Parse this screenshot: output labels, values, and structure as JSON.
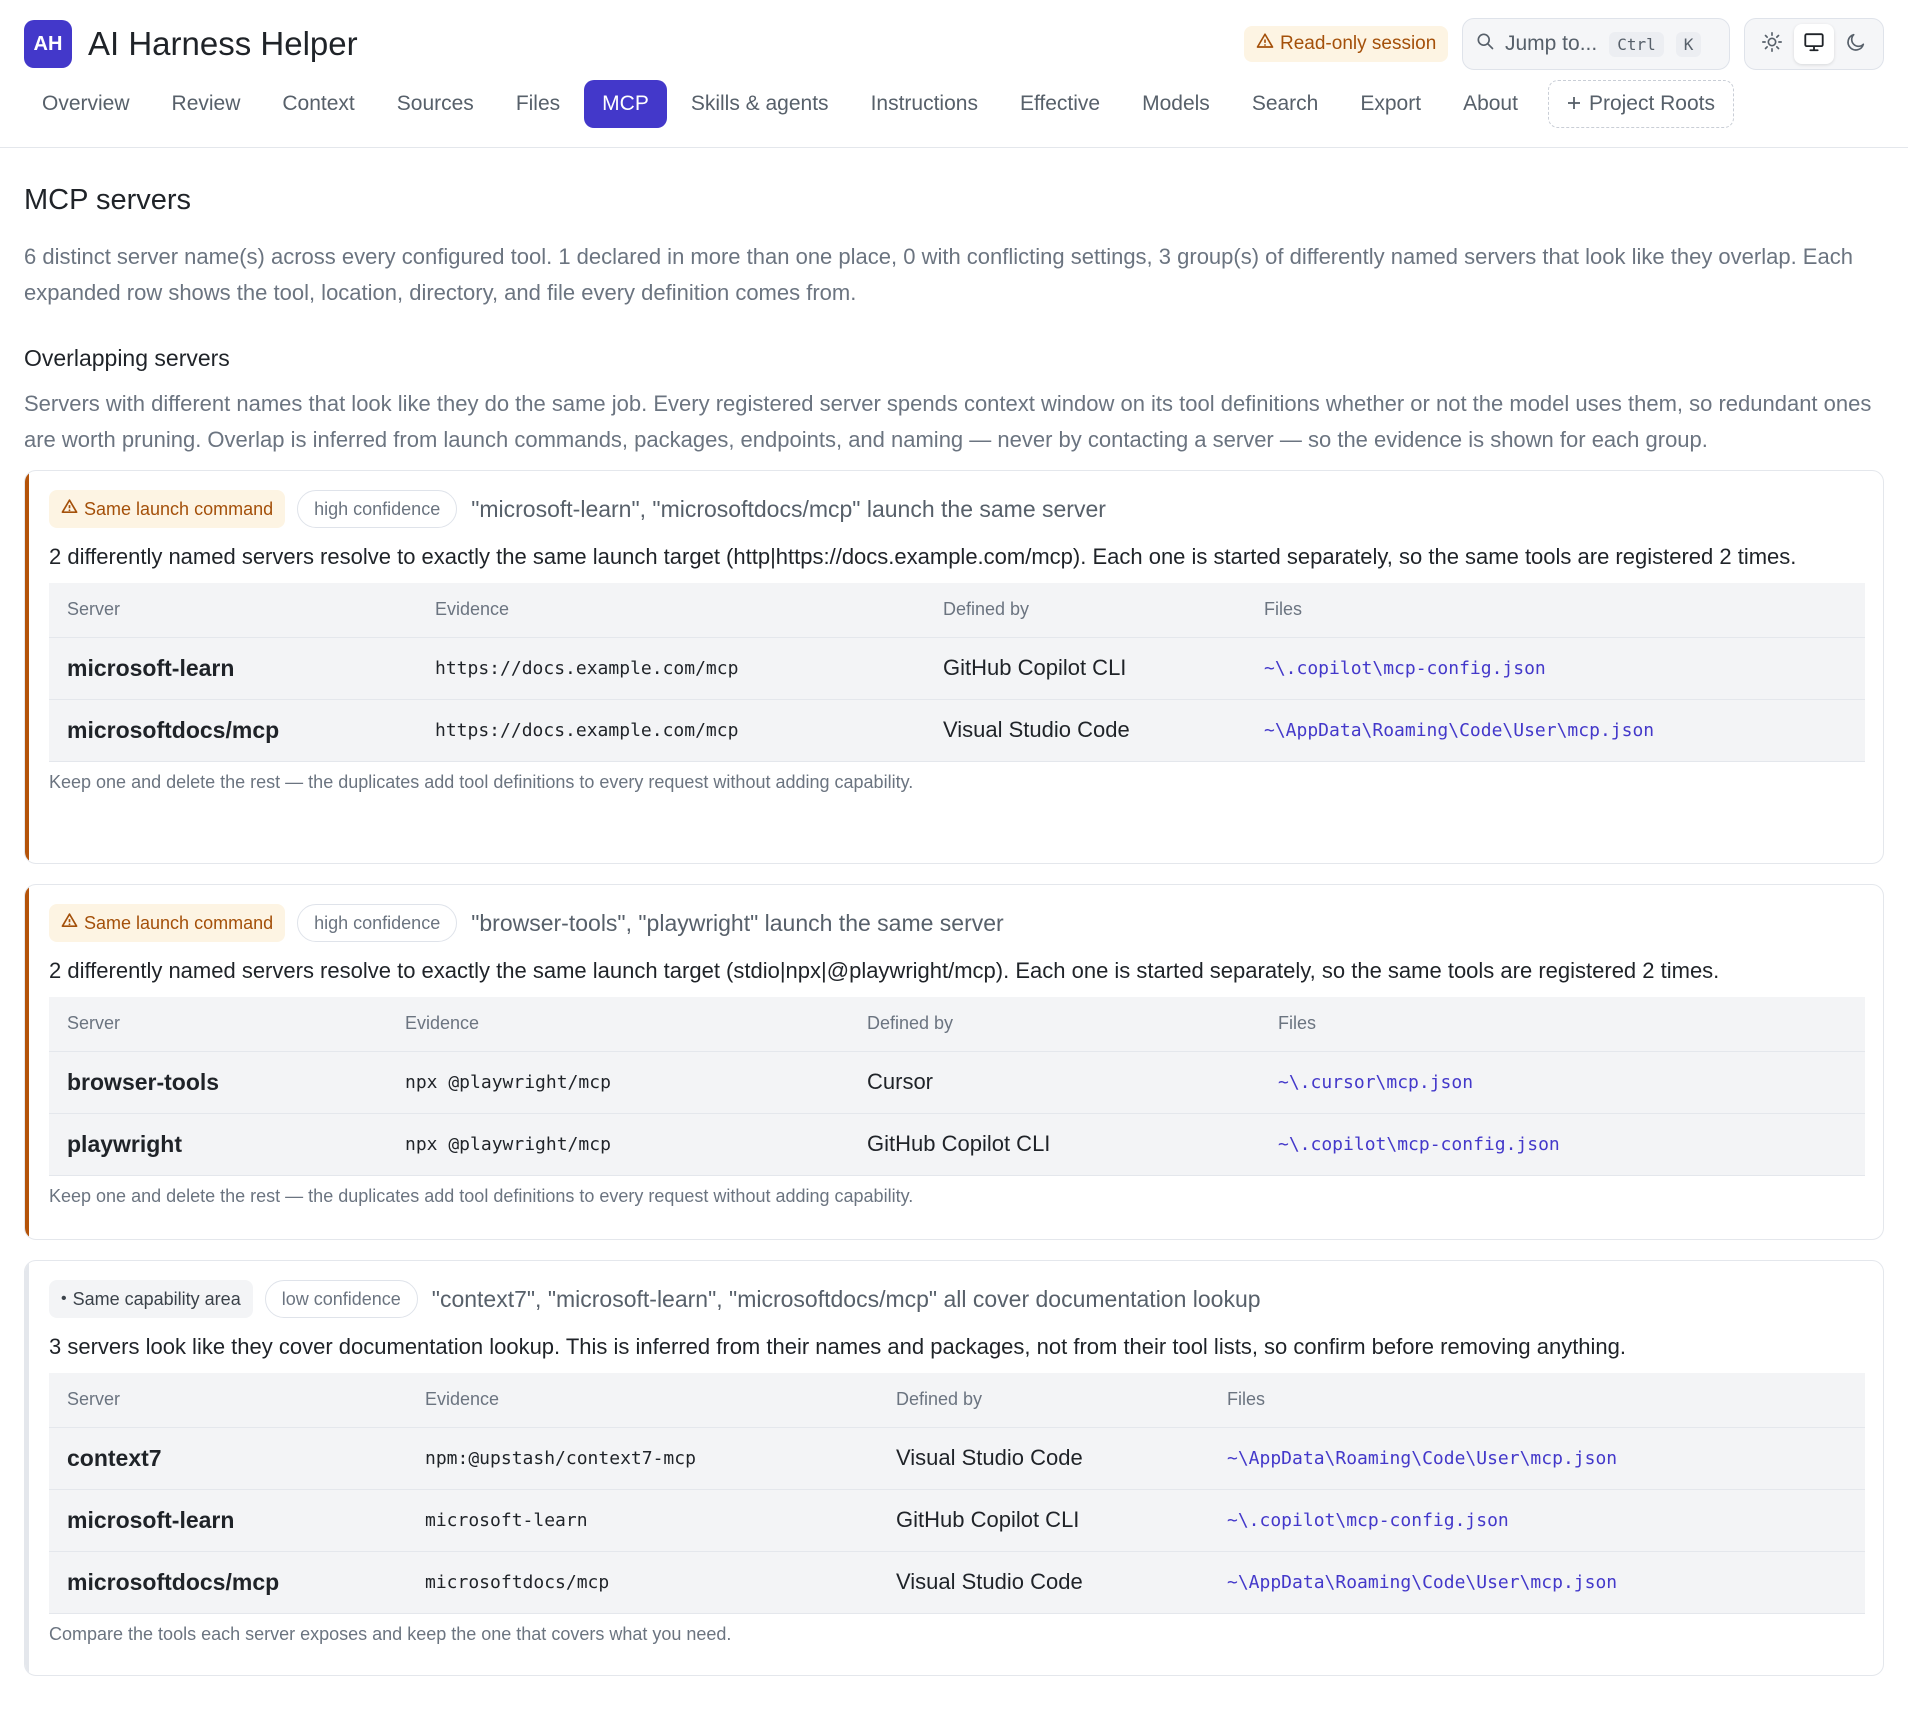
{
  "app": {
    "logo": "AH",
    "title": "AI Harness Helper",
    "readonly_badge": "Read-only session",
    "jump_placeholder": "Jump to...",
    "jump_kbd1": "Ctrl",
    "jump_kbd2": "K"
  },
  "tabs": [
    {
      "label": "Overview"
    },
    {
      "label": "Review"
    },
    {
      "label": "Context"
    },
    {
      "label": "Sources"
    },
    {
      "label": "Files"
    },
    {
      "label": "MCP",
      "active": true
    },
    {
      "label": "Skills & agents"
    },
    {
      "label": "Instructions"
    },
    {
      "label": "Effective"
    },
    {
      "label": "Models"
    },
    {
      "label": "Search"
    },
    {
      "label": "Export"
    },
    {
      "label": "About"
    }
  ],
  "roots_label": "Project Roots",
  "page": {
    "title": "MCP servers",
    "summary": "6 distinct server name(s) across every configured tool. 1 declared in more than one place, 0 with conflicting settings, 3 group(s) of differently named servers that look like they overlap. Each expanded row shows the tool, location, directory, and file every definition comes from.",
    "section_title": "Overlapping servers",
    "section_desc": "Servers with different names that look like they do the same job. Every registered server spends context window on its tool definitions whether or not the model uses them, so redundant ones are worth pruning. Overlap is inferred from launch commands, packages, endpoints, and naming — never by contacting a server — so the evidence is shown for each group."
  },
  "table_headers": {
    "server": "Server",
    "evidence": "Evidence",
    "defined_by": "Defined by",
    "files": "Files"
  },
  "colors": {
    "accent": "#4338ca",
    "warning": "#a4500a",
    "card_high_border": "#b45309"
  },
  "groups": [
    {
      "badge": "Same launch command",
      "confidence": "high confidence",
      "title": "\"microsoft-learn\", \"microsoftdocs/mcp\" launch the same server",
      "desc": "2 differently named servers resolve to exactly the same launch target (http|https://docs.example.com/mcp). Each one is started separately, so the same tools are registered 2 times.",
      "rows": [
        {
          "server": "microsoft-learn",
          "evidence": "https://docs.example.com/mcp",
          "defined_by": "GitHub Copilot CLI",
          "file": "~\\.copilot\\mcp-config.json"
        },
        {
          "server": "microsoftdocs/mcp",
          "evidence": "https://docs.example.com/mcp",
          "defined_by": "Visual Studio Code",
          "file": "~\\AppData\\Roaming\\Code\\User\\mcp.json"
        }
      ],
      "foot": "Keep one and delete the rest — the duplicates add tool definitions to every request without adding capability."
    },
    {
      "badge": "Same launch command",
      "confidence": "high confidence",
      "title": "\"browser-tools\", \"playwright\" launch the same server",
      "desc": "2 differently named servers resolve to exactly the same launch target (stdio|npx|@playwright/mcp). Each one is started separately, so the same tools are registered 2 times.",
      "rows": [
        {
          "server": "browser-tools",
          "evidence": "npx @playwright/mcp",
          "defined_by": "Cursor",
          "file": "~\\.cursor\\mcp.json"
        },
        {
          "server": "playwright",
          "evidence": "npx @playwright/mcp",
          "defined_by": "GitHub Copilot CLI",
          "file": "~\\.copilot\\mcp-config.json"
        }
      ],
      "foot": "Keep one and delete the rest — the duplicates add tool definitions to every request without adding capability."
    },
    {
      "badge": "Same capability area",
      "confidence": "low confidence",
      "title": "\"context7\", \"microsoft-learn\", \"microsoftdocs/mcp\" all cover documentation lookup",
      "desc": "3 servers look like they cover documentation lookup. This is inferred from their names and packages, not from their tool lists, so confirm before removing anything.",
      "rows": [
        {
          "server": "context7",
          "evidence": "npm:@upstash/context7-mcp",
          "defined_by": "Visual Studio Code",
          "file": "~\\AppData\\Roaming\\Code\\User\\mcp.json"
        },
        {
          "server": "microsoft-learn",
          "evidence": "microsoft-learn",
          "defined_by": "GitHub Copilot CLI",
          "file": "~\\.copilot\\mcp-config.json"
        },
        {
          "server": "microsoftdocs/mcp",
          "evidence": "microsoftdocs/mcp",
          "defined_by": "Visual Studio Code",
          "file": "~\\AppData\\Roaming\\Code\\User\\mcp.json"
        }
      ],
      "foot": "Compare the tools each server exposes and keep the one that covers what you need."
    }
  ]
}
